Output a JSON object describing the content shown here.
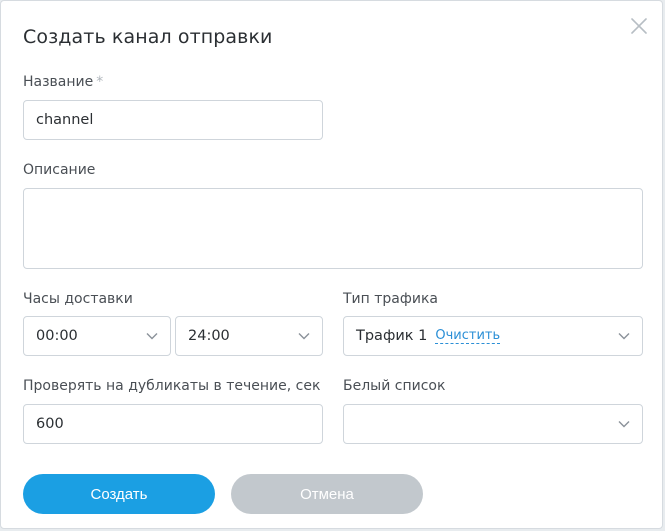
{
  "dialog": {
    "title": "Создать канал отправки"
  },
  "form": {
    "name": {
      "label": "Название",
      "required_mark": "*",
      "value": "channel"
    },
    "description": {
      "label": "Описание",
      "value": ""
    },
    "delivery_hours": {
      "label": "Часы доставки",
      "from": "00:00",
      "to": "24:00"
    },
    "traffic_type": {
      "label": "Тип трафика",
      "value": "Трафик 1",
      "clear_label": "Очистить"
    },
    "duplicate_check": {
      "label": "Проверять на дубликаты в течение, сек",
      "value": "600"
    },
    "whitelist": {
      "label": "Белый список",
      "value": ""
    }
  },
  "actions": {
    "create_label": "Создать",
    "cancel_label": "Отмена"
  },
  "colors": {
    "primary": "#1b9fe3",
    "secondary": "#c2c8cd",
    "link": "#2b8fd6"
  },
  "icons": {
    "close": "close-icon",
    "dropdown": "chevron-down-icon"
  }
}
